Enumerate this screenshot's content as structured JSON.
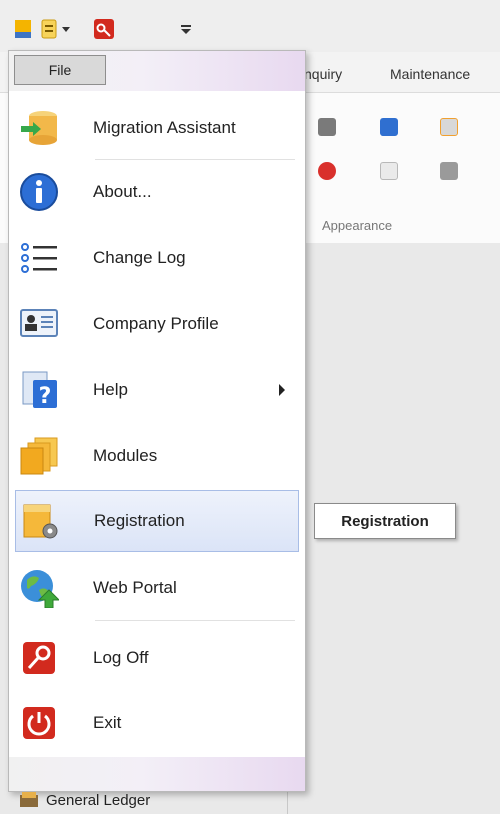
{
  "ribbon": {
    "tabs": [
      "nquiry",
      "Maintenance"
    ],
    "group_label": "Appearance"
  },
  "file_menu": {
    "tab_label": "File",
    "items": [
      {
        "label": "Migration Assistant",
        "icon": "database-arrow-icon"
      },
      {
        "label": "About...",
        "icon": "info-icon"
      },
      {
        "label": "Change Log",
        "icon": "list-icon"
      },
      {
        "label": "Company Profile",
        "icon": "id-card-icon"
      },
      {
        "label": "Help",
        "icon": "help-book-icon"
      },
      {
        "label": "Modules",
        "icon": "folders-icon"
      },
      {
        "label": "Registration",
        "icon": "registration-gear-icon"
      },
      {
        "label": "Web Portal",
        "icon": "globe-arrow-icon"
      },
      {
        "label": "Log Off",
        "icon": "key-icon"
      },
      {
        "label": "Exit",
        "icon": "power-icon"
      }
    ]
  },
  "tooltip": {
    "text": "Registration"
  },
  "navigation": {
    "bottom_item": "General Ledger"
  },
  "colors": {
    "accent_hover": "#dbe4f7",
    "menu_border": "#b9b9b9"
  }
}
